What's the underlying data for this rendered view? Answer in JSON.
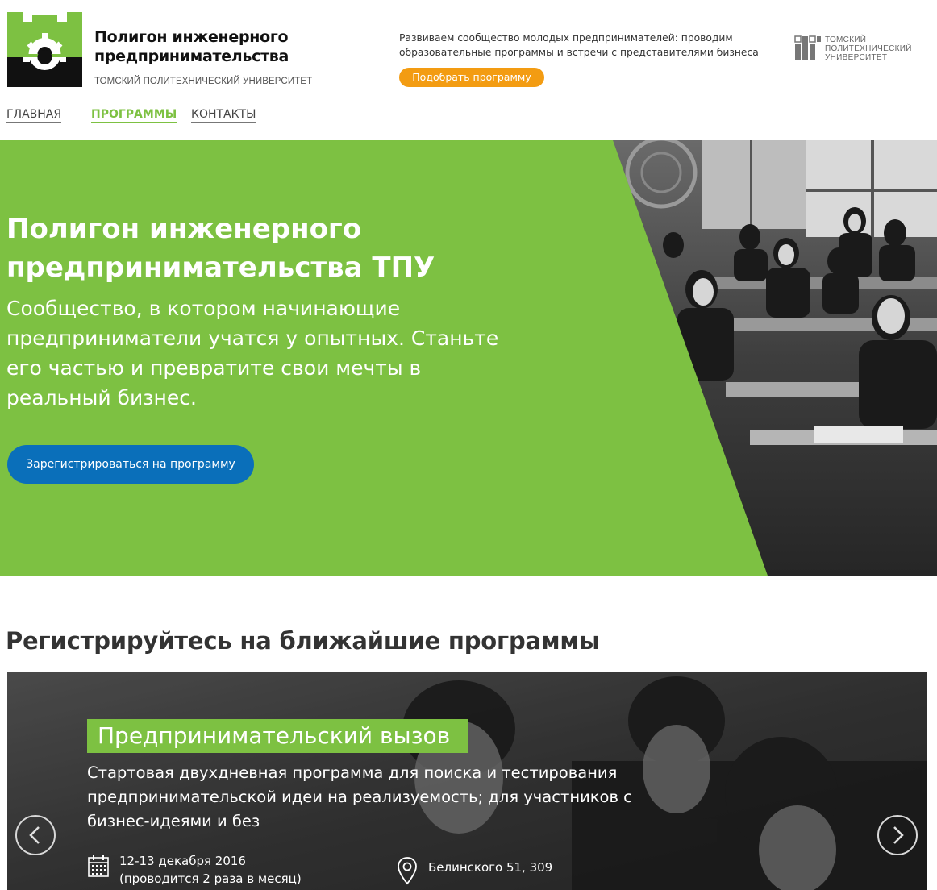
{
  "header": {
    "brand_title_line1": "Полигон инженерного",
    "brand_title_line2": "предпринимательства",
    "brand_subtitle": "ТОМСКИЙ ПОЛИТЕХНИЧЕСКИЙ УНИВЕРСИТЕТ",
    "description": "Развиваем сообщество молодых предпринимателей: проводим образовательные программы и встречи с представителями бизнеса",
    "pick_button": "Подобрать программу",
    "tpu_line1": "ТОМСКИЙ",
    "tpu_line2": "ПОЛИТЕХНИЧЕСКИЙ",
    "tpu_line3": "УНИВЕРСИТЕТ",
    "logo_icon": "gear-briefcase-logo-icon",
    "tpu_icon": "tpu-logo-icon"
  },
  "nav": {
    "items": [
      {
        "label": "ГЛАВНАЯ",
        "active": false
      },
      {
        "label": "ПРОГРАММЫ",
        "active": true
      },
      {
        "label": "КОНТАКТЫ",
        "active": false
      }
    ]
  },
  "hero": {
    "title": "Полигон инженерного предпринимательства ТПУ",
    "subtitle": "Сообщество, в котором начинающие предприниматели учатся у опытных. Станьте его частью и превратите свои мечты в реальный бизнес.",
    "register_button": "Зарегистрироваться на программу"
  },
  "programs": {
    "section_title": "Регистрируйтесь на ближайшие программы",
    "current": {
      "name": "Предпринимательский вызов",
      "description": "Стартовая двухдневная программа для поиска и тестирования предпринимательской идеи на реализуемость; для участников с бизнес-идеями и без",
      "date": "12-13 декабря 2016",
      "frequency": "(проводится 2 раза в месяц)",
      "address": "Белинского 51, 309",
      "date_icon": "calendar-icon",
      "address_icon": "map-pin-icon"
    },
    "prev_icon": "chevron-left-icon",
    "next_icon": "chevron-right-icon"
  },
  "colors": {
    "accent_green": "#7dc142",
    "button_orange": "#f39c12",
    "button_blue": "#0a6fba"
  }
}
